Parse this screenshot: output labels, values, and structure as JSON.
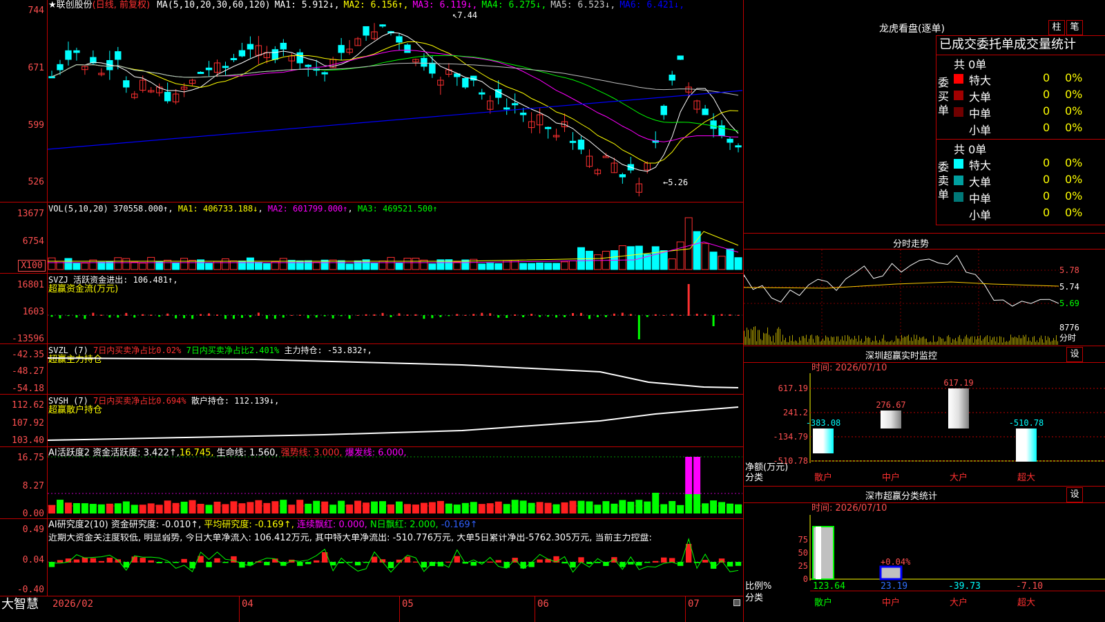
{
  "stock": {
    "star": "★",
    "name": "联创股份",
    "mode": "(日线, 前复权)"
  },
  "ma_legend": [
    {
      "label": "MA(5,10,20,30,60,120)",
      "color": "#ffffff"
    },
    {
      "label": "MA1: 5.912↓",
      "color": "#ffffff"
    },
    {
      "label": "MA2: 6.156↑",
      "color": "#ffff00"
    },
    {
      "label": "MA3: 6.119↓",
      "color": "#ff00ff"
    },
    {
      "label": "MA4: 6.275↓",
      "color": "#00ff00"
    },
    {
      "label": "MA5: 6.523↓",
      "color": "#cccccc"
    },
    {
      "label": "MA6: 6.421↓",
      "color": "#0000ff"
    }
  ],
  "price_axis": [
    "744",
    "671",
    "599",
    "526"
  ],
  "price_marks": {
    "high": "7.44",
    "low": "5.26"
  },
  "vol": {
    "label": "VOL(5,10,20) ",
    "value": "370558.000↑",
    "ma1": "MA1: 406733.188↓",
    "ma2": "MA2: 601799.000↑",
    "ma3": "MA3: 469521.500↑",
    "axis": [
      "13677",
      "6754",
      "X100"
    ]
  },
  "svzj": {
    "label": "SVZJ  活跃资金进出: 106.481↑,",
    "sub": "超赢资金流(万元)",
    "axis": [
      "16801",
      "1603",
      "-13596"
    ]
  },
  "svzl": {
    "label": "SVZL (7)",
    "p1": "7日内买卖净占比0.02%",
    "p2": "7日内买卖净占比2.401%",
    "p3": "主力持仓: -53.832↑,",
    "sub": "超赢主力持仓",
    "axis": [
      "-42.35",
      "-48.27",
      "-54.18"
    ]
  },
  "svsh": {
    "label": "SVSH (7)",
    "p1": "7日内买卖净占比0.694%",
    "p2": "散户持仓: 112.139↓,",
    "sub": "超赢散户持仓",
    "axis": [
      "112.62",
      "107.92",
      "103.40"
    ]
  },
  "ai1": {
    "label": "AI活跃度2 资金活跃度: 3.422↑,",
    "v2": "16.745,",
    "v3": "生命线: 1.560,",
    "v4": "强势线: 3.000,",
    "v5": "爆发线: 6.000,",
    "axis": [
      "16.75",
      "8.27",
      "0.00"
    ]
  },
  "ai2": {
    "label": "AI研究度2(10) 资金研究度: -0.010↑,",
    "v2": "平均研究度: -0.169↑,",
    "v3": "连续飘红: 0.000,",
    "v4": "N日飘红: 2.000,",
    "v5": "-0.169↑",
    "text": "近期大资金关注度较低, 明显弱势, 今日大单净流入: 106.412万元, 其中特大单净流出: -510.776万元, 大单5日累计净出-5762.305万元, 当前主力控盘:",
    "axis": [
      "0.49",
      "0.04",
      "-0.40"
    ]
  },
  "dates": [
    "2026/02",
    "04",
    "05",
    "06",
    "07"
  ],
  "brand": "大智慧",
  "longhu": {
    "title": "龙虎看盘(逐单)",
    "btn1": "柱",
    "btn2": "笔",
    "header": "已成交委托单成交量统计",
    "buy": {
      "title": "共 0单",
      "side_label": "委买单",
      "rows": [
        {
          "name": "特大",
          "count": "0",
          "pct": "0%",
          "color": "#ff0000"
        },
        {
          "name": "大单",
          "count": "0",
          "pct": "0%",
          "color": "#a00000"
        },
        {
          "name": "中单",
          "count": "0",
          "pct": "0%",
          "color": "#700000"
        },
        {
          "name": "小单",
          "count": "0",
          "pct": "0%",
          "color": ""
        }
      ]
    },
    "sell": {
      "title": "共 0单",
      "side_label": "委卖单",
      "rows": [
        {
          "name": "特大",
          "count": "0",
          "pct": "0%",
          "color": "#00ffff"
        },
        {
          "name": "大单",
          "count": "0",
          "pct": "0%",
          "color": "#00a0a0"
        },
        {
          "name": "中单",
          "count": "0",
          "pct": "0%",
          "color": "#007878"
        },
        {
          "name": "小单",
          "count": "0",
          "pct": "0%",
          "color": ""
        }
      ]
    }
  },
  "fenshi": {
    "title": "分时走势",
    "axis": [
      "5.78",
      "5.74",
      "5.69"
    ],
    "vol": "8776",
    "unit": "分时"
  },
  "sz_monitor": {
    "title": "深圳超赢实时监控",
    "btn": "设",
    "time": "时间: 2026/07/10",
    "axis": [
      "617.19",
      "241.2",
      "-134.79",
      "-510.78"
    ],
    "ylabel": "净额(万元)",
    "xlabel": "分类",
    "bars": [
      {
        "cat": "散户",
        "value": "-383.08"
      },
      {
        "cat": "中户",
        "value": "276.67"
      },
      {
        "cat": "大户",
        "value": "617.19"
      },
      {
        "cat": "超大",
        "value": "-510.78"
      }
    ]
  },
  "sz_class": {
    "title": "深市超赢分类统计",
    "btn": "设",
    "time": "时间: 2026/07/10",
    "axis": [
      "75",
      "50",
      "25",
      "0"
    ],
    "ylabel": "比例%",
    "xlabel": "分类",
    "bars": [
      {
        "cat": "散户",
        "value": "123.64"
      },
      {
        "cat": "中户",
        "value": "23.19"
      },
      {
        "cat": "大户",
        "value": "-39.73"
      },
      {
        "cat": "超大",
        "value": "-7.10"
      }
    ],
    "mid_label": "+0.04%"
  }
}
